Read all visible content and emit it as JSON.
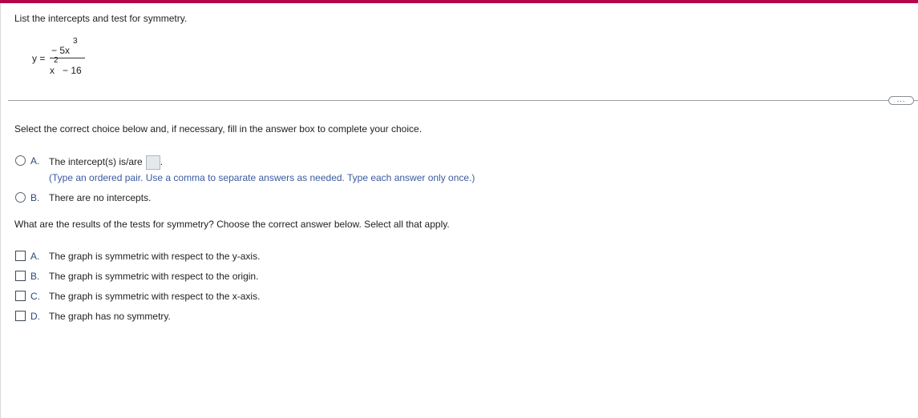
{
  "colors": {
    "top_bar": "#b5064c",
    "hint_text": "#3a5aa0"
  },
  "problem": {
    "prompt": "List the intercepts and test for symmetry.",
    "equation": {
      "lhs": "y =",
      "numerator": "− 5x",
      "numerator_exponent": "3",
      "denominator_base": "x",
      "denominator_exponent": "2",
      "denominator_rest": "− 16"
    }
  },
  "more_button": {
    "label": "..."
  },
  "part1": {
    "instruction": "Select the correct choice below and, if necessary, fill in the answer box to complete your choice.",
    "options": [
      {
        "letter": "A.",
        "text": "The intercept(s) is/are",
        "suffix": ".",
        "hint": "(Type an ordered pair. Use a comma to separate answers as needed. Type each answer only once.)"
      },
      {
        "letter": "B.",
        "text": "There are no intercepts."
      }
    ]
  },
  "part2": {
    "question": "What are the results of the tests for symmetry? Choose the correct answer below. Select all that apply.",
    "options": [
      {
        "letter": "A.",
        "text": "The graph is symmetric with respect to the y-axis."
      },
      {
        "letter": "B.",
        "text": "The graph is symmetric with respect to the origin."
      },
      {
        "letter": "C.",
        "text": "The graph is symmetric with respect to the x-axis."
      },
      {
        "letter": "D.",
        "text": "The graph has no symmetry."
      }
    ]
  }
}
